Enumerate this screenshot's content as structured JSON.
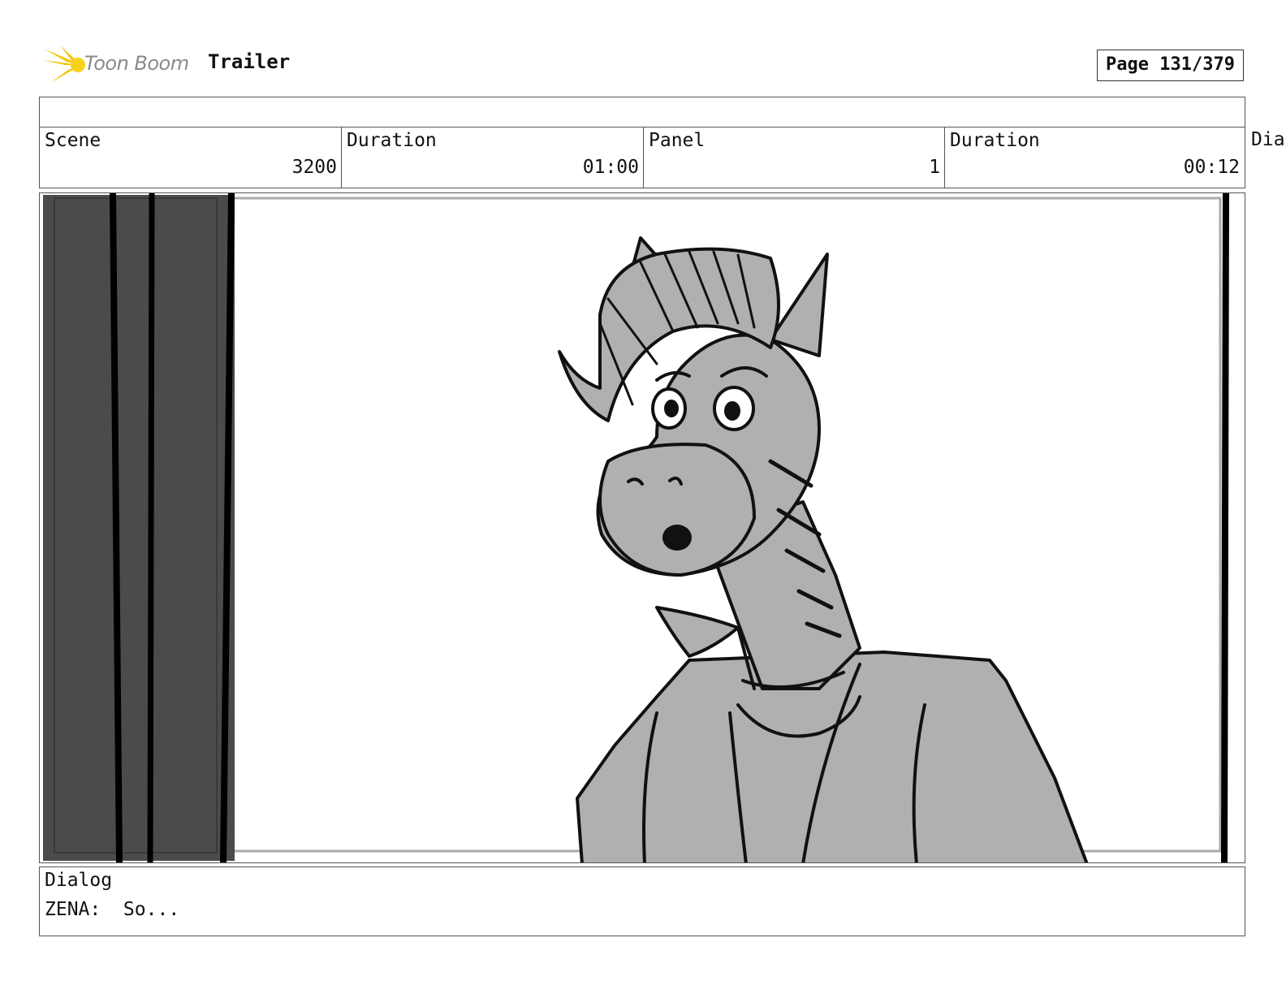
{
  "header": {
    "logo_text": "Toon Boom",
    "project_title": "Trailer",
    "page_label": "Page 131/379"
  },
  "info": {
    "scene_label": "Scene",
    "scene_value": "3200",
    "scene_duration_label": "Duration",
    "scene_duration_value": "01:00",
    "panel_label": "Panel",
    "panel_value": "1",
    "panel_duration_label": "Duration",
    "panel_duration_value": "00:12",
    "overflow_label": "Dia"
  },
  "dialog": {
    "label": "Dialog",
    "text": "ZENA:  So..."
  },
  "colors": {
    "curtain": "#4b4b4b",
    "character_fill": "#b0b0b0",
    "ink": "#111111",
    "logo_yellow": "#f5c400"
  }
}
